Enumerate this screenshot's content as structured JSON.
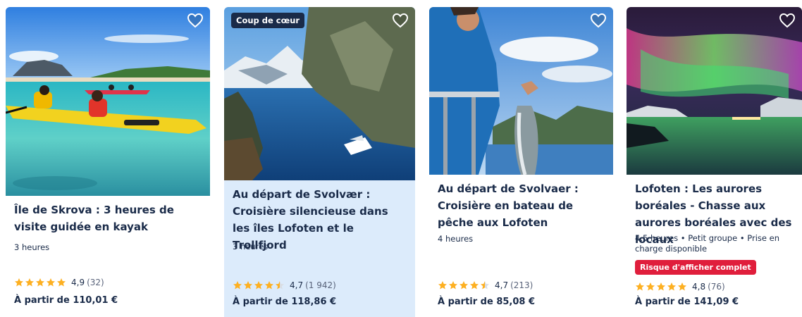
{
  "colors": {
    "text": "#1a2b49",
    "star": "#fdb022",
    "highlight_card": "#dcebfb",
    "badge_dark": "#1a2b49",
    "badge_red": "#e01e3c"
  },
  "cards": [
    {
      "photo": "kayakers-on-turquoise-water",
      "title": "Île de Skrova : 3 heures de visite guidée en kayak",
      "duration": "3 heures",
      "rating": "4,9",
      "rating_value": 4.9,
      "reviews": "(32)",
      "price": "À partir de 110,01 €",
      "favorite_icon": "heart-outline-icon"
    },
    {
      "photo": "cruise-boat-in-fjord",
      "badge": "Coup de cœur",
      "title": "Au départ de Svolvær : Croisière silencieuse dans les îles Lofoten et le Trollfjord",
      "duration": "3 heures",
      "rating": "4,7",
      "rating_value": 4.7,
      "reviews": "(1 942)",
      "price": "À partir de 118,86 €",
      "favorite_icon": "heart-outline-icon"
    },
    {
      "photo": "fisherman-holding-cod",
      "title": "Au départ de Svolvaer : Croisière en bateau de pêche aux Lofoten",
      "duration": "4 heures",
      "rating": "4,7",
      "rating_value": 4.7,
      "reviews": "(213)",
      "price": "À partir de 85,08 €",
      "favorite_icon": "heart-outline-icon"
    },
    {
      "photo": "northern-lights-over-lake",
      "title": "Lofoten : Les aurores boréales - Chasse aux aurores boréales avec des locaux",
      "duration": "4,5 heures • Petit groupe • Prise en charge disponible",
      "risk_badge": "Risque d'afficher complet",
      "rating": "4,8",
      "rating_value": 4.8,
      "reviews": "(76)",
      "price": "À partir de 141,09 €",
      "favorite_icon": "heart-outline-icon"
    }
  ]
}
